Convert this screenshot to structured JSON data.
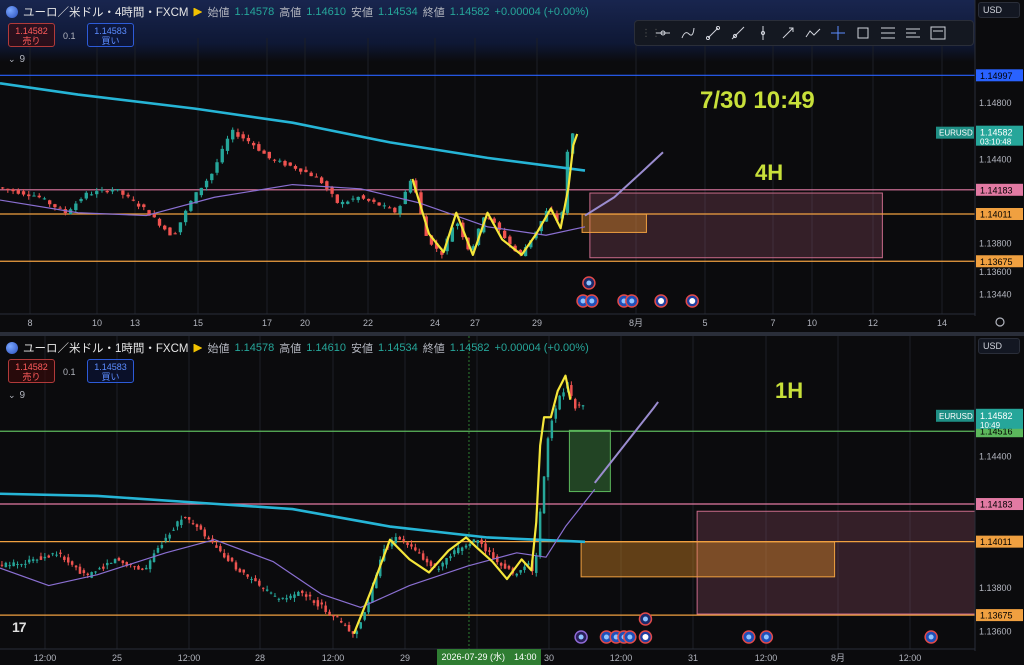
{
  "panes": [
    {
      "id": "4h",
      "header": {
        "symbol": "ユーロ／米ドル・4時間・FXCM",
        "open_label": "始値",
        "open": "1.14578",
        "high_label": "高値",
        "high": "1.14610",
        "low_label": "安値",
        "low": "1.14534",
        "close_label": "終値",
        "close": "1.14582",
        "change": "+0.00004 (+0.00%)"
      },
      "sell_box": {
        "price": "1.14582",
        "label": "売り"
      },
      "buy_box": {
        "price": "1.14583",
        "label": "買い"
      },
      "qty": "0.1",
      "indicator_count": "9",
      "currency": "USD",
      "annotation_time": "7/30 10:49",
      "annotation_tf": "4H",
      "chart_data": {
        "type": "candlestick",
        "ylim": [
          1.133,
          1.1512
        ],
        "y_ticks": [
          "1.14800",
          "1.14400",
          "1.13800",
          "1.13600",
          "1.13440"
        ],
        "x_ticks": [
          "8",
          "10",
          "13",
          "15",
          "17",
          "20",
          "22",
          "24",
          "27",
          "29",
          "8月",
          "5",
          "7",
          "10",
          "12",
          "14"
        ],
        "symbol_tag": "EURUSD",
        "price_tag": {
          "value": "1.14582",
          "countdown": "03:10:48"
        },
        "levels": [
          {
            "value": 1.14997,
            "label": "1.14997",
            "color": "#2962ff"
          },
          {
            "value": 1.14183,
            "label": "1.14183",
            "color": "#e27aa3"
          },
          {
            "value": 1.14011,
            "label": "1.14011",
            "color": "#f0a040"
          },
          {
            "value": 1.13675,
            "label": "1.13675",
            "color": "#f0a040"
          }
        ],
        "zones": [
          {
            "x0": 0.605,
            "x1": 0.905,
            "y0": 1.1416,
            "y1": 1.137,
            "fill": "rgba(201,107,138,0.22)",
            "stroke": "#c96b8a"
          },
          {
            "x0": 0.597,
            "x1": 0.663,
            "y0": 1.1401,
            "y1": 1.1388,
            "fill": "rgba(240,150,40,0.38)",
            "stroke": "#f0a040"
          }
        ],
        "ohlc_seed": 7,
        "num_candles": 110,
        "candle_x_start": 0.0,
        "candle_x_end": 0.59,
        "path": [
          [
            0.0,
            1.142
          ],
          [
            0.04,
            1.1414
          ],
          [
            0.07,
            1.1402
          ],
          [
            0.09,
            1.1415
          ],
          [
            0.12,
            1.1419
          ],
          [
            0.15,
            1.1405
          ],
          [
            0.18,
            1.1385
          ],
          [
            0.2,
            1.1412
          ],
          [
            0.22,
            1.143
          ],
          [
            0.24,
            1.146
          ],
          [
            0.26,
            1.1452
          ],
          [
            0.28,
            1.144
          ],
          [
            0.31,
            1.1433
          ],
          [
            0.33,
            1.1426
          ],
          [
            0.35,
            1.1408
          ],
          [
            0.37,
            1.1413
          ],
          [
            0.39,
            1.1408
          ],
          [
            0.41,
            1.1402
          ],
          [
            0.425,
            1.1428
          ],
          [
            0.44,
            1.1385
          ],
          [
            0.455,
            1.1372
          ],
          [
            0.47,
            1.1398
          ],
          [
            0.485,
            1.1373
          ],
          [
            0.5,
            1.1402
          ],
          [
            0.52,
            1.1385
          ],
          [
            0.535,
            1.1371
          ],
          [
            0.55,
            1.1386
          ],
          [
            0.565,
            1.1405
          ],
          [
            0.578,
            1.1393
          ],
          [
            0.586,
            1.1455
          ],
          [
            0.59,
            1.1458
          ]
        ],
        "ema": [
          [
            0.0,
            1.1494
          ],
          [
            0.08,
            1.1486
          ],
          [
            0.2,
            1.1476
          ],
          [
            0.3,
            1.1466
          ],
          [
            0.4,
            1.1452
          ],
          [
            0.5,
            1.1441
          ],
          [
            0.6,
            1.1432
          ]
        ],
        "sma": [
          [
            0.0,
            1.1411
          ],
          [
            0.08,
            1.1402
          ],
          [
            0.15,
            1.14
          ],
          [
            0.22,
            1.1413
          ],
          [
            0.3,
            1.1422
          ],
          [
            0.37,
            1.1419
          ],
          [
            0.43,
            1.1409
          ],
          [
            0.5,
            1.1392
          ],
          [
            0.56,
            1.1386
          ],
          [
            0.6,
            1.1392
          ]
        ],
        "projection": [
          [
            0.6,
            1.14
          ],
          [
            0.63,
            1.1413
          ],
          [
            0.66,
            1.1432
          ],
          [
            0.68,
            1.1445
          ]
        ],
        "zigzag": [
          [
            0.423,
            1.1426
          ],
          [
            0.44,
            1.1387
          ],
          [
            0.455,
            1.1374
          ],
          [
            0.468,
            1.1402
          ],
          [
            0.485,
            1.1372
          ],
          [
            0.5,
            1.1402
          ],
          [
            0.515,
            1.1383
          ],
          [
            0.535,
            1.1372
          ],
          [
            0.55,
            1.1387
          ],
          [
            0.565,
            1.1405
          ],
          [
            0.575,
            1.1391
          ],
          [
            0.583,
            1.142
          ],
          [
            0.588,
            1.145
          ],
          [
            0.592,
            1.1458
          ]
        ],
        "events": [
          [
            0.604,
            "r"
          ],
          [
            0.598,
            "c"
          ],
          [
            0.607,
            "c"
          ],
          [
            0.64,
            "c"
          ],
          [
            0.648,
            "c"
          ],
          [
            0.678,
            "u"
          ],
          [
            0.71,
            "u"
          ]
        ]
      }
    },
    {
      "id": "1h",
      "header": {
        "symbol": "ユーロ／米ドル・1時間・FXCM",
        "open_label": "始値",
        "open": "1.14578",
        "high_label": "高値",
        "high": "1.14610",
        "low_label": "安値",
        "low": "1.14534",
        "close_label": "終値",
        "close": "1.14582",
        "change": "+0.00004 (+0.00%)"
      },
      "sell_box": {
        "price": "1.14582",
        "label": "売り"
      },
      "buy_box": {
        "price": "1.14583",
        "label": "買い"
      },
      "qty": "0.1",
      "indicator_count": "9",
      "currency": "USD",
      "annotation_tf": "1H",
      "tv_logo": "17",
      "crosshair_date": "2026-07-29 (水)　14:00",
      "chart_data": {
        "type": "candlestick",
        "ylim": [
          1.1352,
          1.1486
        ],
        "y_ticks": [
          "1.14400",
          "1.13800",
          "1.13600"
        ],
        "x_ticks": [
          "12:00",
          "25",
          "12:00",
          "28",
          "12:00",
          "29",
          "12:00",
          "30",
          "12:00",
          "31",
          "12:00",
          "8月",
          "12:00"
        ],
        "symbol_tag": "EURUSD",
        "price_tag": {
          "value": "1.14582",
          "countdown": "10:49"
        },
        "levels": [
          {
            "value": 1.14516,
            "label": "1.14516",
            "color": "#5cb85c"
          },
          {
            "value": 1.14183,
            "label": "1.14183",
            "color": "#e27aa3"
          },
          {
            "value": 1.14011,
            "label": "1.14011",
            "color": "#f0a040"
          },
          {
            "value": 1.13675,
            "label": "1.13675",
            "color": "#f0a040"
          }
        ],
        "zones": [
          {
            "x0": 0.715,
            "x1": 1.0,
            "y0": 1.1415,
            "y1": 1.1368,
            "fill": "rgba(201,107,138,0.22)",
            "stroke": "#c96b8a"
          },
          {
            "x0": 0.596,
            "x1": 0.856,
            "y0": 1.1401,
            "y1": 1.1385,
            "fill": "rgba(240,150,40,0.38)",
            "stroke": "#f0a040"
          },
          {
            "x0": 0.584,
            "x1": 0.626,
            "y0": 1.1452,
            "y1": 1.1424,
            "fill": "rgba(76,175,80,0.35)",
            "stroke": "#5cb85c"
          }
        ],
        "ohlc_seed": 13,
        "num_candles": 150,
        "candle_x_start": 0.0,
        "candle_x_end": 0.6,
        "path": [
          [
            0.0,
            1.139
          ],
          [
            0.03,
            1.1392
          ],
          [
            0.06,
            1.1396
          ],
          [
            0.09,
            1.1385
          ],
          [
            0.12,
            1.1393
          ],
          [
            0.15,
            1.1388
          ],
          [
            0.17,
            1.1402
          ],
          [
            0.19,
            1.1413
          ],
          [
            0.21,
            1.1405
          ],
          [
            0.23,
            1.1395
          ],
          [
            0.25,
            1.1387
          ],
          [
            0.27,
            1.138
          ],
          [
            0.29,
            1.1374
          ],
          [
            0.31,
            1.1378
          ],
          [
            0.33,
            1.1372
          ],
          [
            0.35,
            1.1365
          ],
          [
            0.365,
            1.1358
          ],
          [
            0.38,
            1.1373
          ],
          [
            0.395,
            1.1398
          ],
          [
            0.41,
            1.1403
          ],
          [
            0.43,
            1.1396
          ],
          [
            0.45,
            1.1388
          ],
          [
            0.47,
            1.1397
          ],
          [
            0.49,
            1.1402
          ],
          [
            0.51,
            1.1393
          ],
          [
            0.53,
            1.1386
          ],
          [
            0.545,
            1.1392
          ],
          [
            0.55,
            1.1384
          ],
          [
            0.555,
            1.141
          ],
          [
            0.565,
            1.1452
          ],
          [
            0.575,
            1.1467
          ],
          [
            0.585,
            1.1474
          ],
          [
            0.59,
            1.1463
          ]
        ],
        "ema": [
          [
            0.0,
            1.1423
          ],
          [
            0.1,
            1.1422
          ],
          [
            0.2,
            1.1419
          ],
          [
            0.3,
            1.1416
          ],
          [
            0.4,
            1.1408
          ],
          [
            0.5,
            1.1403
          ],
          [
            0.6,
            1.1401
          ]
        ],
        "sma": [
          [
            0.0,
            1.1389
          ],
          [
            0.05,
            1.1381
          ],
          [
            0.1,
            1.1386
          ],
          [
            0.17,
            1.1396
          ],
          [
            0.22,
            1.1402
          ],
          [
            0.28,
            1.1392
          ],
          [
            0.33,
            1.1377
          ],
          [
            0.37,
            1.1371
          ],
          [
            0.42,
            1.1381
          ],
          [
            0.48,
            1.139
          ],
          [
            0.53,
            1.1396
          ],
          [
            0.56,
            1.1394
          ],
          [
            0.58,
            1.1408
          ],
          [
            0.61,
            1.1425
          ]
        ],
        "projection": [
          [
            0.61,
            1.1428
          ],
          [
            0.64,
            1.1445
          ],
          [
            0.67,
            1.1462
          ],
          [
            0.675,
            1.1465
          ]
        ],
        "zigzag": [
          [
            0.363,
            1.1359
          ],
          [
            0.38,
            1.1378
          ],
          [
            0.4,
            1.1402
          ],
          [
            0.42,
            1.1393
          ],
          [
            0.44,
            1.1387
          ],
          [
            0.46,
            1.1397
          ],
          [
            0.478,
            1.1403
          ],
          [
            0.49,
            1.1398
          ],
          [
            0.505,
            1.1392
          ],
          [
            0.52,
            1.1384
          ],
          [
            0.535,
            1.1393
          ],
          [
            0.545,
            1.1388
          ],
          [
            0.55,
            1.141
          ],
          [
            0.554,
            1.1445
          ],
          [
            0.558,
            1.1458
          ],
          [
            0.565,
            1.1458
          ],
          [
            0.572,
            1.147
          ],
          [
            0.58,
            1.1477
          ],
          [
            0.585,
            1.1466
          ]
        ],
        "events": [
          [
            0.596,
            "b"
          ],
          [
            0.622,
            "c"
          ],
          [
            0.632,
            "c"
          ],
          [
            0.64,
            "c"
          ],
          [
            0.646,
            "c"
          ],
          [
            0.662,
            "r"
          ],
          [
            0.662,
            "u"
          ],
          [
            0.768,
            "c"
          ],
          [
            0.786,
            "c"
          ],
          [
            0.955,
            "c"
          ]
        ],
        "crosshair_x": 0.481
      }
    }
  ],
  "toolbar_icons": [
    "cursor-line-icon",
    "brush-icon",
    "trend-line-icon",
    "ray-icon",
    "vertical-line-icon",
    "arrow-line-icon",
    "path-icon",
    "crosshair-icon",
    "rectangle-icon",
    "fib-icon",
    "ruler-icon",
    "text-note-icon"
  ]
}
